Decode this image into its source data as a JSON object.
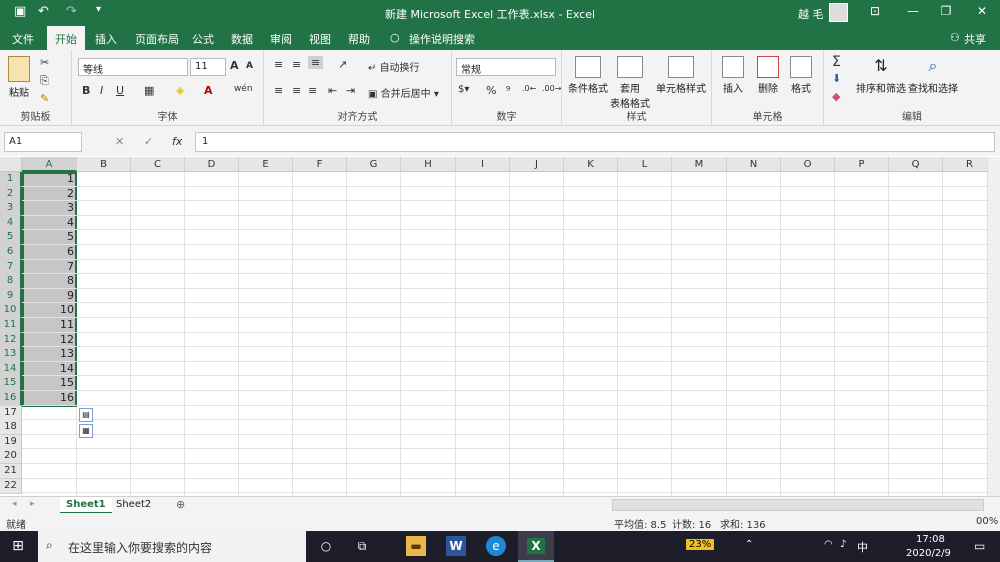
{
  "titlebar": {
    "title": "新建 Microsoft Excel 工作表.xlsx  -  Excel",
    "user": "越 毛",
    "save_icon": "▣",
    "undo_icon": "↶",
    "redo_icon": "↷",
    "customize_icon": "▾",
    "ribbon_options": "⊡",
    "minimize": "—",
    "restore": "❐",
    "close": "✕"
  },
  "tabs": [
    "文件",
    "开始",
    "插入",
    "页面布局",
    "公式",
    "数据",
    "审阅",
    "视图",
    "帮助"
  ],
  "active_tab": "开始",
  "tell_me": "操作说明搜索",
  "share": "共享",
  "ribbon": {
    "clipboard": {
      "paste": "粘贴",
      "label": "剪贴板"
    },
    "font": {
      "name": "等线",
      "size": "11",
      "grow": "A",
      "shrink": "A",
      "bold": "B",
      "italic": "I",
      "underline": "U",
      "label": "字体"
    },
    "alignment": {
      "wrap": "自动换行",
      "merge": "合并后居中",
      "label": "对齐方式"
    },
    "number": {
      "format": "常规",
      "percent": "%",
      "comma": "⁹",
      "label": "数字"
    },
    "styles": {
      "conditional": "条件格式",
      "table1": "套用",
      "table2": "表格格式",
      "cell_styles": "单元格样式",
      "label": "样式"
    },
    "cells": {
      "insert": "插入",
      "delete": "删除",
      "format": "格式",
      "label": "单元格"
    },
    "editing": {
      "sum": "Σ",
      "sort": "排序和筛选",
      "find": "查找和选择",
      "label": "编辑"
    }
  },
  "formula_bar": {
    "name_box": "A1",
    "cancel": "✕",
    "enter": "✓",
    "fx": "fx",
    "value": "1"
  },
  "columns": [
    "A",
    "B",
    "C",
    "D",
    "E",
    "F",
    "G",
    "H",
    "I",
    "J",
    "K",
    "L",
    "M",
    "N",
    "O",
    "P",
    "Q",
    "R"
  ],
  "rows": [
    "1",
    "2",
    "3",
    "4",
    "5",
    "6",
    "7",
    "8",
    "9",
    "10",
    "11",
    "12",
    "13",
    "14",
    "15",
    "16",
    "17",
    "18",
    "19",
    "20",
    "21",
    "22"
  ],
  "cells_a": [
    "1",
    "2",
    "3",
    "4",
    "5",
    "6",
    "7",
    "8",
    "9",
    "10",
    "11",
    "12",
    "13",
    "14",
    "15",
    "16"
  ],
  "sheets": [
    "Sheet1",
    "Sheet2"
  ],
  "add_sheet": "⊕",
  "status": {
    "ready": "就绪",
    "average": "平均值: 8.5",
    "count": "计数: 16",
    "sum": "求和: 136",
    "zoom": "00%"
  },
  "taskbar": {
    "search_placeholder": "在这里输入你要搜索的内容",
    "battery": "23%",
    "ime": "中",
    "time": "17:08",
    "date": "2020/2/9"
  }
}
